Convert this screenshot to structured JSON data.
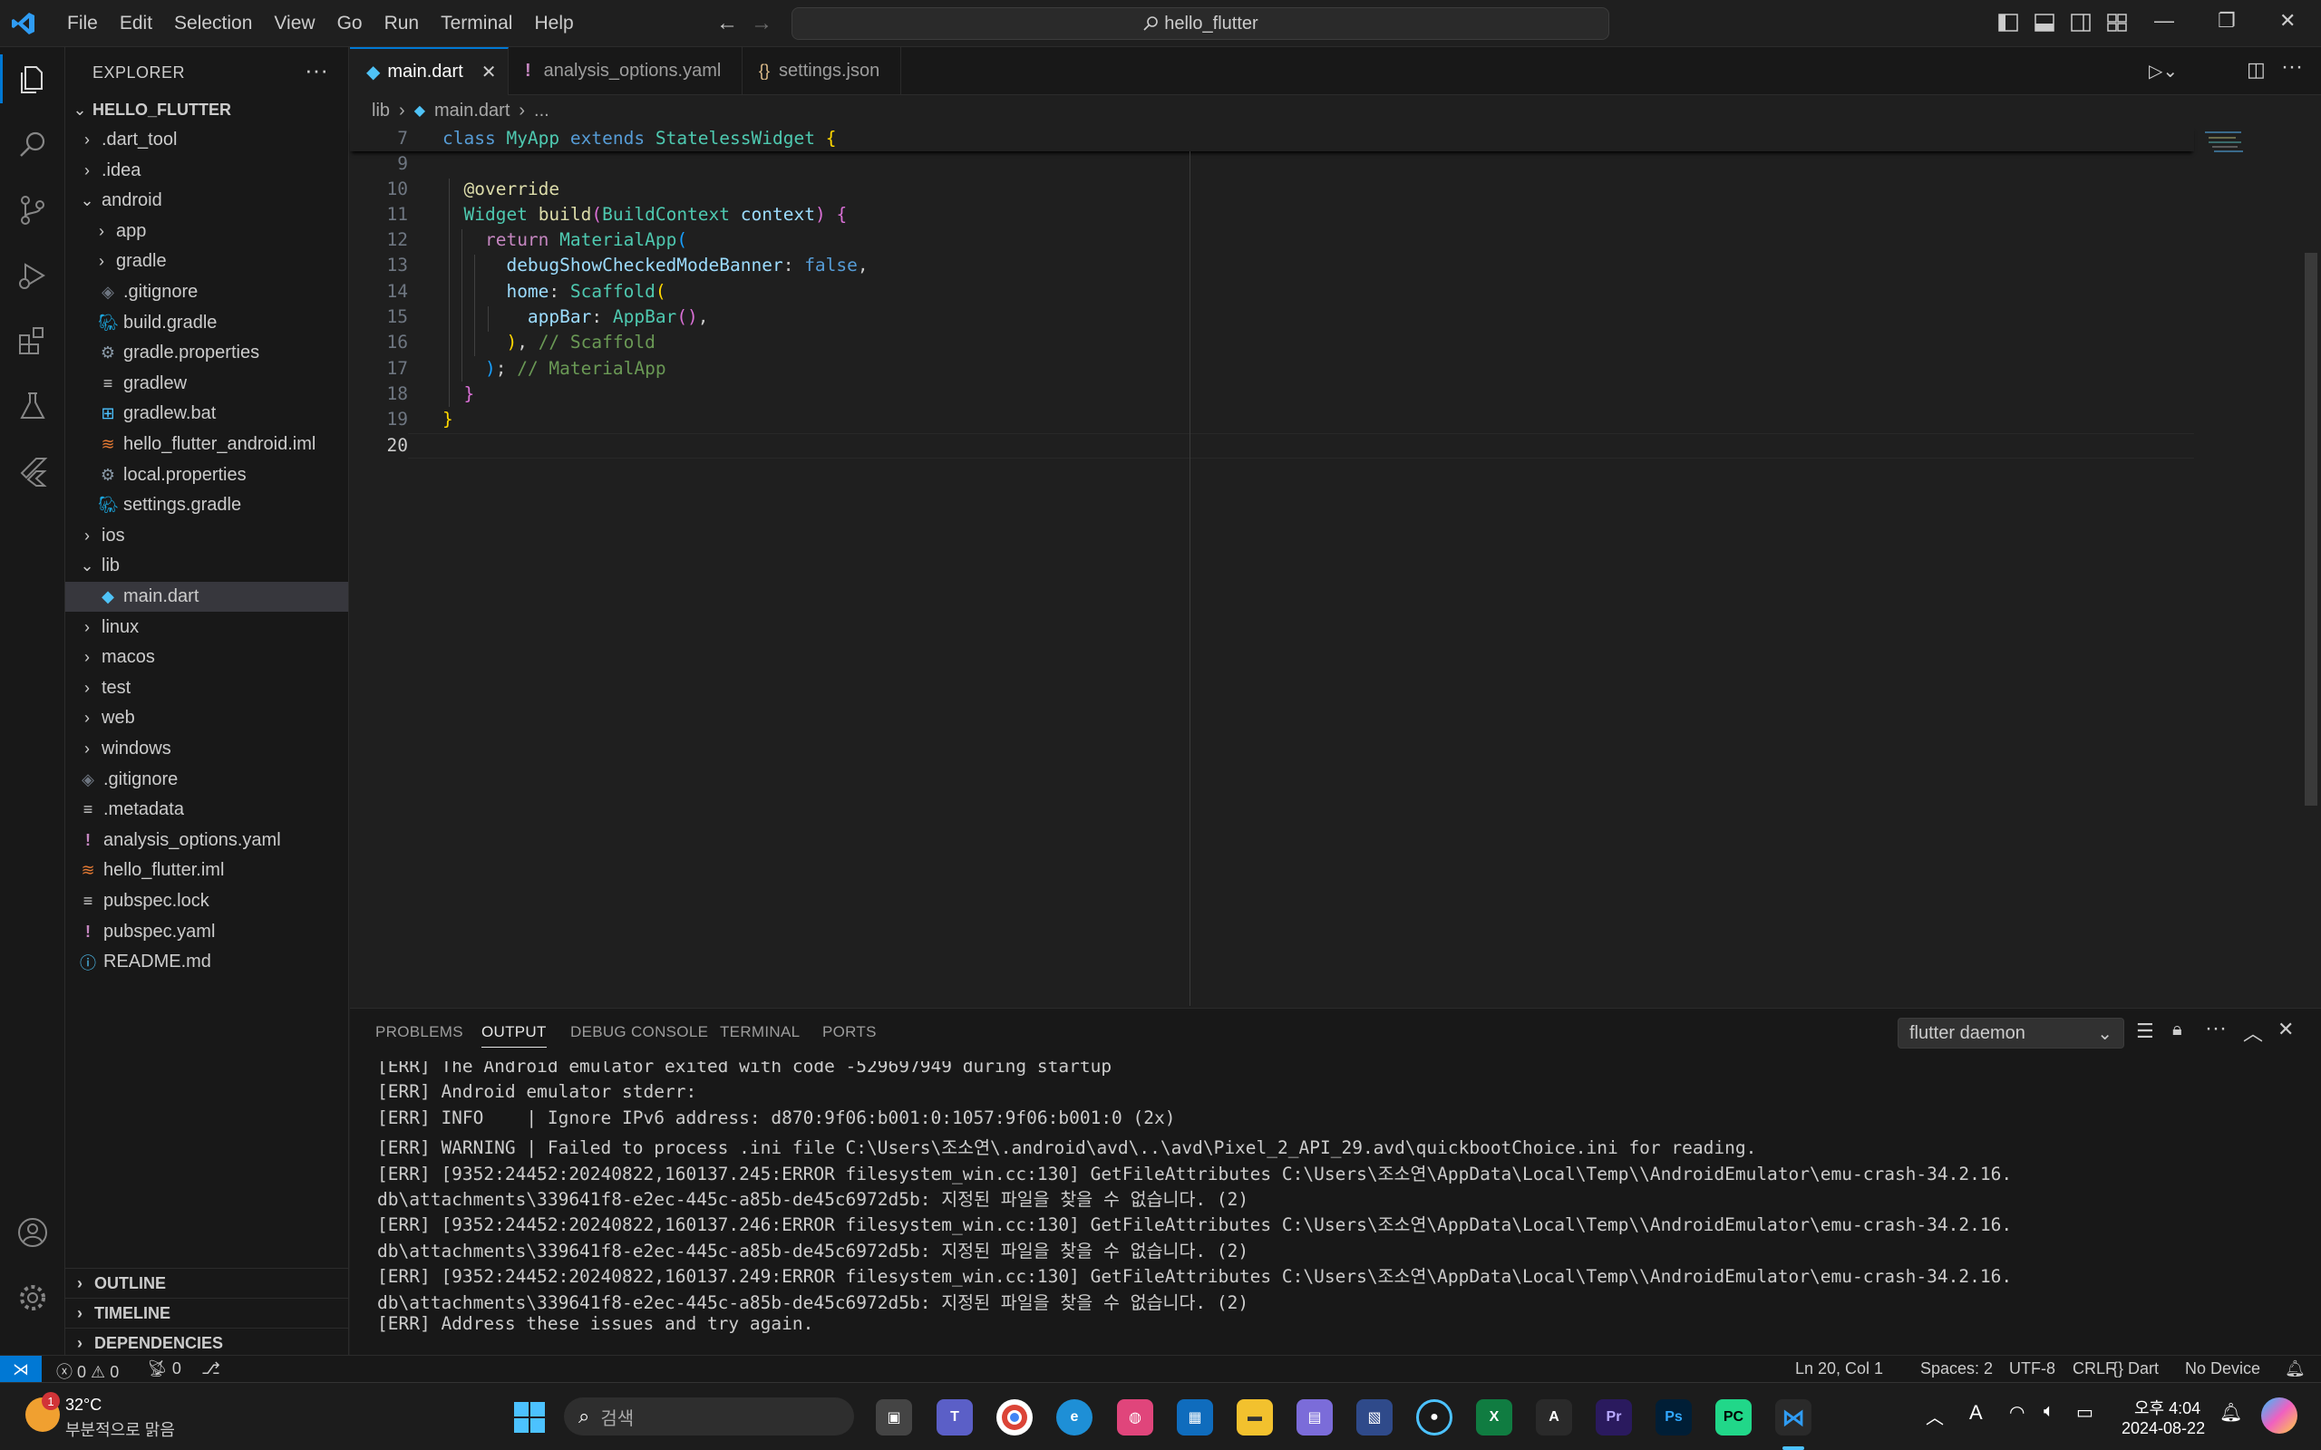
{
  "menu": [
    "File",
    "Edit",
    "Selection",
    "View",
    "Go",
    "Run",
    "Terminal",
    "Help"
  ],
  "search": "hello_flutter",
  "explorer": {
    "title": "EXPLORER",
    "project": "HELLO_FLUTTER",
    "items": [
      {
        "label": ".dart_tool",
        "type": "folder",
        "depth": 1,
        "open": false
      },
      {
        "label": ".idea",
        "type": "folder",
        "depth": 1,
        "open": false
      },
      {
        "label": "android",
        "type": "folder",
        "depth": 1,
        "open": true
      },
      {
        "label": "app",
        "type": "folder",
        "depth": 2,
        "open": false
      },
      {
        "label": "gradle",
        "type": "folder",
        "depth": 2,
        "open": false
      },
      {
        "label": ".gitignore",
        "type": "git",
        "depth": 2
      },
      {
        "label": "build.gradle",
        "type": "gradle",
        "depth": 2
      },
      {
        "label": "gradle.properties",
        "type": "gear",
        "depth": 2
      },
      {
        "label": "gradlew",
        "type": "lines",
        "depth": 2
      },
      {
        "label": "gradlew.bat",
        "type": "windows",
        "depth": 2
      },
      {
        "label": "hello_flutter_android.iml",
        "type": "rss",
        "depth": 2
      },
      {
        "label": "local.properties",
        "type": "gear",
        "depth": 2
      },
      {
        "label": "settings.gradle",
        "type": "gradle",
        "depth": 2
      },
      {
        "label": "ios",
        "type": "folder",
        "depth": 1,
        "open": false
      },
      {
        "label": "lib",
        "type": "folder",
        "depth": 1,
        "open": true
      },
      {
        "label": "main.dart",
        "type": "dart",
        "depth": 2,
        "selected": true
      },
      {
        "label": "linux",
        "type": "folder",
        "depth": 1,
        "open": false
      },
      {
        "label": "macos",
        "type": "folder",
        "depth": 1,
        "open": false
      },
      {
        "label": "test",
        "type": "folder",
        "depth": 1,
        "open": false
      },
      {
        "label": "web",
        "type": "folder",
        "depth": 1,
        "open": false
      },
      {
        "label": "windows",
        "type": "folder",
        "depth": 1,
        "open": false
      },
      {
        "label": ".gitignore",
        "type": "git",
        "depth": 1
      },
      {
        "label": ".metadata",
        "type": "lines",
        "depth": 1
      },
      {
        "label": "analysis_options.yaml",
        "type": "yaml",
        "depth": 1
      },
      {
        "label": "hello_flutter.iml",
        "type": "rss",
        "depth": 1
      },
      {
        "label": "pubspec.lock",
        "type": "lines",
        "depth": 1
      },
      {
        "label": "pubspec.yaml",
        "type": "yaml",
        "depth": 1
      },
      {
        "label": "README.md",
        "type": "info",
        "depth": 1
      }
    ],
    "sections": [
      "OUTLINE",
      "TIMELINE",
      "DEPENDENCIES"
    ]
  },
  "tabs": [
    {
      "label": "main.dart",
      "icon": "dart",
      "active": true
    },
    {
      "label": "analysis_options.yaml",
      "icon": "yaml",
      "active": false
    },
    {
      "label": "settings.json",
      "icon": "json",
      "active": false
    }
  ],
  "breadcrumb": [
    "lib",
    "main.dart",
    "..."
  ],
  "code": {
    "sticky": "class MyApp extends StatelessWidget {",
    "lines": [
      "7",
      "9",
      "10",
      "11",
      "12",
      "13",
      "14",
      "15",
      "16",
      "17",
      "18",
      "19",
      "20"
    ]
  },
  "panel": {
    "tabs": [
      "PROBLEMS",
      "OUTPUT",
      "DEBUG CONSOLE",
      "TERMINAL",
      "PORTS"
    ],
    "active": "OUTPUT",
    "channel": "flutter daemon",
    "output": [
      "[ERR] The Android emulator exited with code -529697949 during startup",
      "[ERR] Android emulator stderr:",
      "[ERR] INFO    | Ignore IPv6 address: d870:9f06:b001:0:1057:9f06:b001:0 (2x)",
      "[ERR] WARNING | Failed to process .ini file C:\\Users\\조소연\\.android\\avd\\..\\avd\\Pixel_2_API_29.avd\\quickbootChoice.ini for reading.",
      "[ERR] [9352:24452:20240822,160137.245:ERROR filesystem_win.cc:130] GetFileAttributes C:\\Users\\조소연\\AppData\\Local\\Temp\\\\AndroidEmulator\\emu-crash-34.2.16.",
      "db\\attachments\\339641f8-e2ec-445c-a85b-de45c6972d5b: 지정된 파일을 찾을 수 없습니다. (2)",
      "[ERR] [9352:24452:20240822,160137.246:ERROR filesystem_win.cc:130] GetFileAttributes C:\\Users\\조소연\\AppData\\Local\\Temp\\\\AndroidEmulator\\emu-crash-34.2.16.",
      "db\\attachments\\339641f8-e2ec-445c-a85b-de45c6972d5b: 지정된 파일을 찾을 수 없습니다. (2)",
      "[ERR] [9352:24452:20240822,160137.249:ERROR filesystem_win.cc:130] GetFileAttributes C:\\Users\\조소연\\AppData\\Local\\Temp\\\\AndroidEmulator\\emu-crash-34.2.16.",
      "db\\attachments\\339641f8-e2ec-445c-a85b-de45c6972d5b: 지정된 파일을 찾을 수 없습니다. (2)",
      "[ERR] Address these issues and try again."
    ]
  },
  "status": {
    "errors": "0",
    "warnings": "0",
    "ports": "0",
    "position": "Ln 20, Col 1",
    "spaces": "Spaces: 2",
    "encoding": "UTF-8",
    "eol": "CRLF",
    "language": "Dart",
    "device": "No Device"
  },
  "taskbar": {
    "weather_temp": "32°C",
    "weather_desc": "부분적으로 맑음",
    "weather_badge": "1",
    "search_placeholder": "검색",
    "time": "오후 4:04",
    "date": "2024-08-22"
  },
  "colors": {
    "accent": "#0078d4",
    "background": "#1f1f1f",
    "sidebar": "#181818"
  }
}
